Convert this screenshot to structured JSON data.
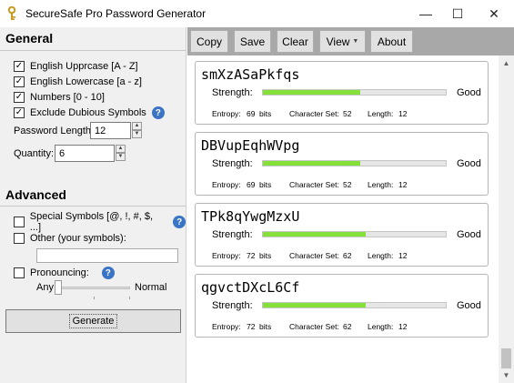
{
  "window": {
    "title": "SecureSafe Pro Password Generator",
    "minimize": "—",
    "maximize": "☐",
    "close": "✕"
  },
  "general": {
    "title": "General",
    "options": [
      {
        "label": "English Upprcase [A - Z]",
        "checked": true
      },
      {
        "label": "English Lowercase [a - z]",
        "checked": true
      },
      {
        "label": "Numbers [0 - 10]",
        "checked": true
      },
      {
        "label": "Exclude Dubious Symbols",
        "checked": true
      }
    ],
    "password_length_label": "Password Length:",
    "password_length_value": "12",
    "quantity_label": "Quantity:",
    "quantity_value": "6"
  },
  "advanced": {
    "title": "Advanced",
    "special_label": "Special Symbols [@, !, #, $, ...]",
    "special_checked": false,
    "other_label": "Other (your symbols):",
    "other_checked": false,
    "other_value": "",
    "pronouncing_label": "Pronouncing:",
    "pronouncing_checked": false,
    "slider_min_label": "Any",
    "slider_max_label": "Normal",
    "slider_position": 0,
    "generate_label": "Generate"
  },
  "toolbar": {
    "copy": "Copy",
    "save": "Save",
    "clear": "Clear",
    "view": "View",
    "about": "About"
  },
  "labels": {
    "strength": "Strength:",
    "entropy": "Entropy:",
    "bits": "bits",
    "charset": "Character Set:",
    "length": "Length:"
  },
  "passwords": [
    {
      "password": "smXzASaPkfqs",
      "strength": "Good",
      "strength_fraction": 0.53,
      "entropy": "69",
      "charset": "52",
      "length": "12"
    },
    {
      "password": "DBVupEqhWVpg",
      "strength": "Good",
      "strength_fraction": 0.53,
      "entropy": "69",
      "charset": "52",
      "length": "12"
    },
    {
      "password": "TPk8qYwgMzxU",
      "strength": "Good",
      "strength_fraction": 0.56,
      "entropy": "72",
      "charset": "62",
      "length": "12"
    },
    {
      "password": "qgvctDXcL6Cf",
      "strength": "Good",
      "strength_fraction": 0.56,
      "entropy": "72",
      "charset": "62",
      "length": "12"
    }
  ],
  "colors": {
    "strength_bar": "#86e03a",
    "toolbar_bg": "#a8a8a8",
    "help_icon": "#3a74c4"
  }
}
